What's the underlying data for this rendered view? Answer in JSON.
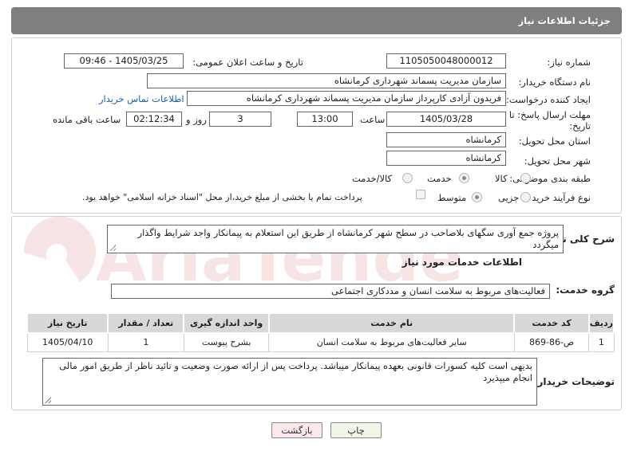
{
  "header": {
    "title": "جزئیات اطلاعات نیاز"
  },
  "watermark_text": "AriaTender.net",
  "fields": {
    "need_number": {
      "label": "شماره نیاز:",
      "value": "1105050048000012"
    },
    "announce_datetime": {
      "label": "تاریخ و ساعت اعلان عمومی:",
      "value": "1405/03/25 - 09:46"
    },
    "buyer_org": {
      "label": "نام دستگاه خریدار:",
      "value": "سازمان مدیریت پسماند شهرداری کرمانشاه"
    },
    "requester": {
      "label": "ایجاد کننده درخواست:",
      "value": "فریدون آزادی کارپرداز سازمان مدیریت پسماند شهرداری کرمانشاه",
      "contact_link": "اطلاعات تماس خریدار"
    },
    "deadline": {
      "label": "مهلت ارسال پاسخ: تا",
      "label2": "تاریخ:",
      "date": "1405/03/28",
      "time_label": "ساعت",
      "time": "13:00",
      "days": "3",
      "days_label": "روز و",
      "remaining": "02:12:34",
      "remaining_label": "ساعت باقی مانده"
    },
    "province": {
      "label": "استان محل تحویل:",
      "value": "کرمانشاه"
    },
    "city": {
      "label": "شهر محل تحویل:",
      "value": "کرمانشاه"
    },
    "category": {
      "label": "طبقه بندی موضوعی:",
      "options": [
        "کالا",
        "خدمت",
        "کالا/خدمت"
      ],
      "selected": "خدمت"
    },
    "process_type": {
      "label": "نوع فرآیند خرید :",
      "options": [
        "جزیی",
        "متوسط"
      ],
      "selected": "متوسط",
      "payment_note": "پرداخت تمام یا بخشی از مبلغ خرید،از محل \"اسناد خزانه اسلامی\" خواهد بود."
    }
  },
  "description": {
    "label": "شرح کلی نیاز:",
    "value": "پروژه جمع آوری سگهای بلاصاحب در سطح شهر کرمانشاه از طریق این استعلام به پیمانکار واجد شرایط واگذار میگردد"
  },
  "services_info": {
    "title": "اطلاعات خدمات مورد نیاز",
    "group_label": "گروه خدمت:",
    "group_value": "فعالیت‌های مربوط به سلامت انسان و مددکاری اجتماعی",
    "table": {
      "headers": [
        "ردیف",
        "کد خدمت",
        "نام خدمت",
        "واحد اندازه گیری",
        "تعداد / مقدار",
        "تاریخ نیاز"
      ],
      "rows": [
        [
          "1",
          "ص-86-869",
          "سایر فعالیت‌های مربوط به سلامت انسان",
          "بشرح پیوست",
          "1",
          "1405/04/10"
        ]
      ]
    }
  },
  "buyer_notes": {
    "label": "توضیحات خریدار:",
    "value": "بدیهی است کلیه کسورات قانونی بعهده پیمانکار میباشد. پرداخت پس از ارائه صورت وضعیت و تائید ناظر از طریق امور مالی انجام میپذیرد"
  },
  "buttons": {
    "back": "بازگشت",
    "print": "چاپ"
  },
  "colors": {
    "header_bg": "#7f7f7f",
    "link": "#1b5fa8",
    "table_header_bg": "#d8d8d8",
    "back_bg": "#fde9ea",
    "print_bg": "#eef7e8"
  }
}
